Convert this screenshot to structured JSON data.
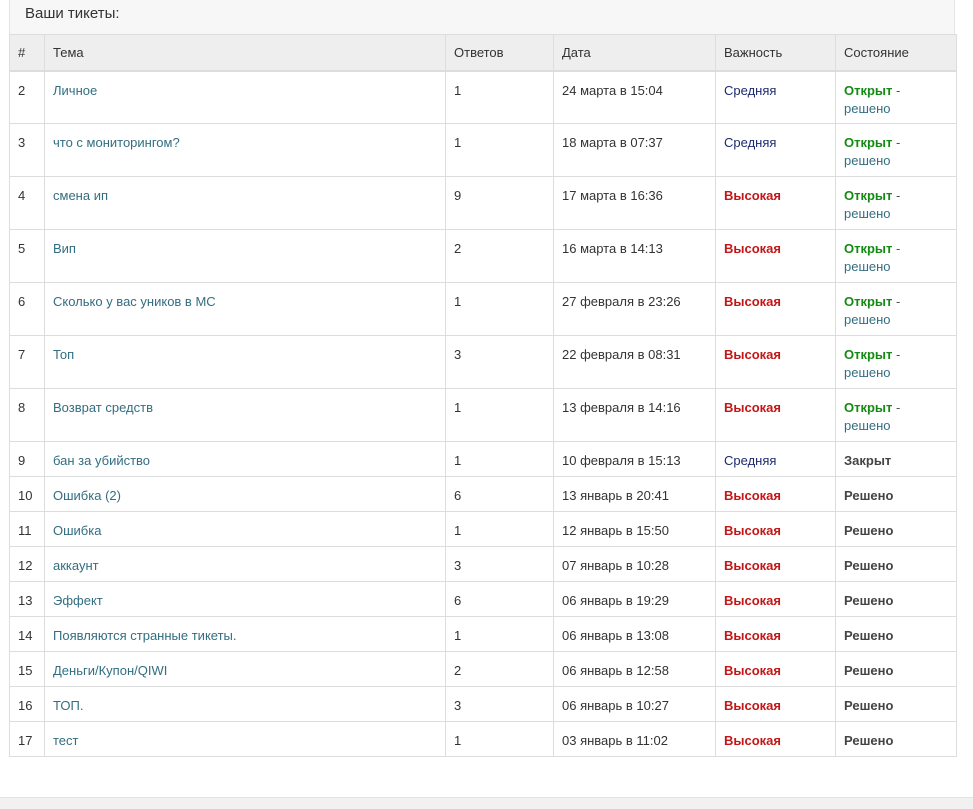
{
  "panel": {
    "title": "Ваши тикеты:"
  },
  "columns": {
    "num": "#",
    "topic": "Тема",
    "replies": "Ответов",
    "date": "Дата",
    "priority": "Важность",
    "status": "Состояние"
  },
  "labels": {
    "dash": "-"
  },
  "rows": [
    {
      "id": "2",
      "topic": "Личное",
      "replies": "1",
      "date": "24 марта в 15:04",
      "priority": "Средняя",
      "status": "Открыт",
      "resolve": "решено"
    },
    {
      "id": "3",
      "topic": "что с мониторингом?",
      "replies": "1",
      "date": "18 марта в 07:37",
      "priority": "Средняя",
      "status": "Открыт",
      "resolve": "решено"
    },
    {
      "id": "4",
      "topic": "смена ип",
      "replies": "9",
      "date": "17 марта в 16:36",
      "priority": "Высокая",
      "status": "Открыт",
      "resolve": "решено"
    },
    {
      "id": "5",
      "topic": "Вип",
      "replies": "2",
      "date": "16 марта в 14:13",
      "priority": "Высокая",
      "status": "Открыт",
      "resolve": "решено"
    },
    {
      "id": "6",
      "topic": "Сколько у вас уников в МС",
      "replies": "1",
      "date": "27 февраля в 23:26",
      "priority": "Высокая",
      "status": "Открыт",
      "resolve": "решено"
    },
    {
      "id": "7",
      "topic": "Топ",
      "replies": "3",
      "date": "22 февраля в 08:31",
      "priority": "Высокая",
      "status": "Открыт",
      "resolve": "решено"
    },
    {
      "id": "8",
      "topic": "Возврат средств",
      "replies": "1",
      "date": "13 февраля в 14:16",
      "priority": "Высокая",
      "status": "Открыт",
      "resolve": "решено"
    },
    {
      "id": "9",
      "topic": "бан за убийство",
      "replies": "1",
      "date": "10 февраля в 15:13",
      "priority": "Средняя",
      "status": "Закрыт"
    },
    {
      "id": "10",
      "topic": "Ошибка (2)",
      "replies": "6",
      "date": "13 январь в 20:41",
      "priority": "Высокая",
      "status": "Решено"
    },
    {
      "id": "11",
      "topic": "Ошибка",
      "replies": "1",
      "date": "12 январь в 15:50",
      "priority": "Высокая",
      "status": "Решено"
    },
    {
      "id": "12",
      "topic": "аккаунт",
      "replies": "3",
      "date": "07 январь в 10:28",
      "priority": "Высокая",
      "status": "Решено"
    },
    {
      "id": "13",
      "topic": "Эффект",
      "replies": "6",
      "date": "06 январь в 19:29",
      "priority": "Высокая",
      "status": "Решено"
    },
    {
      "id": "14",
      "topic": "Появляются странные тикеты.",
      "replies": "1",
      "date": "06 январь в 13:08",
      "priority": "Высокая",
      "status": "Решено"
    },
    {
      "id": "15",
      "topic": "Деньги/Купон/QIWI",
      "replies": "2",
      "date": "06 январь в 12:58",
      "priority": "Высокая",
      "status": "Решено"
    },
    {
      "id": "16",
      "topic": "ТОП.",
      "replies": "3",
      "date": "06 январь в 10:27",
      "priority": "Высокая",
      "status": "Решено"
    },
    {
      "id": "17",
      "topic": "тест",
      "replies": "1",
      "date": "03 январь в 11:02",
      "priority": "Высокая",
      "status": "Решено"
    }
  ],
  "colors": {
    "link": "#336e80",
    "priority_medium": "#1c2a70",
    "priority_high": "#c41616",
    "status_open": "#148a14",
    "status_done": "#444444"
  }
}
